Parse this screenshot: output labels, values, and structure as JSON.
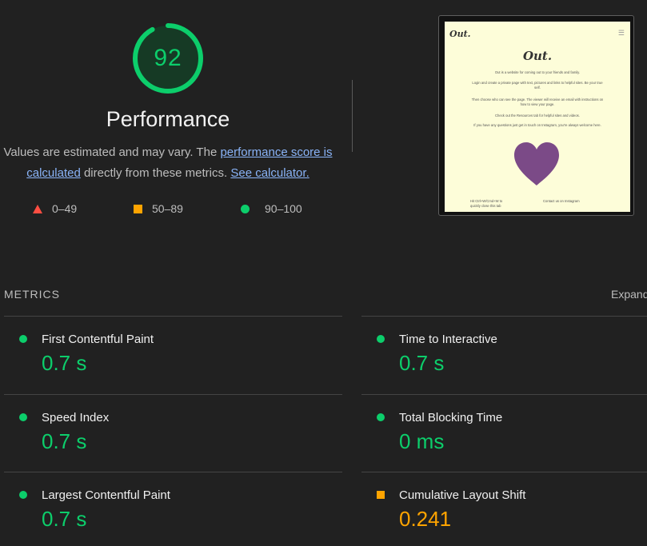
{
  "score": {
    "value": "92",
    "fraction": 0.92,
    "color": "#0cce6b",
    "title": "Performance",
    "desc_prefix": "Values are estimated and may vary. The ",
    "desc_link1": "performance score is calculated",
    "desc_middle": " directly from these metrics. ",
    "desc_link2": "See calculator."
  },
  "legend": [
    {
      "icon": "triangle-icon",
      "color": "#ff4e42",
      "label": "0–49"
    },
    {
      "icon": "square-icon",
      "color": "#ffa400",
      "label": "50–89"
    },
    {
      "icon": "circle-icon",
      "color": "#0cce6b",
      "label": "90–100"
    }
  ],
  "thumbnail": {
    "logo": "Out.",
    "menu_icon": "hamburger-icon",
    "heading": "Out.",
    "paragraphs": [
      "Out is a website for coming out to your friends and family.",
      "Login and create a private page with text, pictures and links to helpful sites. Be your true self.",
      "Then choose who can see the page. The viewer will receive an email with instructions on how to view your page.",
      "Check out the Resources tab for helpful sites and videos.",
      "If you have any questions just get in touch on Instagram, you're always welcome here."
    ],
    "heart_color": "#7b4a87",
    "footer_left": "Hit Ctrl+W/Cmd+W to quickly close this tab",
    "footer_right": "Contact us on Instagram"
  },
  "metrics_section": {
    "title": "METRICS",
    "expand_label": "Expand view"
  },
  "metrics": [
    {
      "name": "First Contentful Paint",
      "value": "0.7 s",
      "rating": "good"
    },
    {
      "name": "Time to Interactive",
      "value": "0.7 s",
      "rating": "good"
    },
    {
      "name": "Speed Index",
      "value": "0.7 s",
      "rating": "good"
    },
    {
      "name": "Total Blocking Time",
      "value": "0 ms",
      "rating": "good"
    },
    {
      "name": "Largest Contentful Paint",
      "value": "0.7 s",
      "rating": "good"
    },
    {
      "name": "Cumulative Layout Shift",
      "value": "0.241",
      "rating": "average"
    }
  ]
}
